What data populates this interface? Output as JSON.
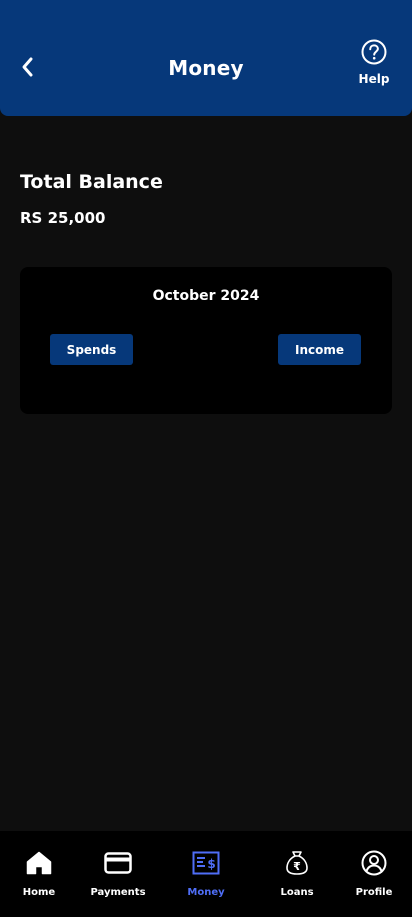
{
  "header": {
    "title": "Money",
    "help_label": "Help"
  },
  "balance": {
    "title": "Total Balance",
    "amount": "RS 25,000"
  },
  "card": {
    "month": "October 2024",
    "spends_label": "Spends",
    "income_label": "Income"
  },
  "nav": {
    "active": "Money",
    "items": [
      {
        "label": "Home",
        "icon": "home-icon"
      },
      {
        "label": "Payments",
        "icon": "card-icon"
      },
      {
        "label": "Money",
        "icon": "money-statement-icon"
      },
      {
        "label": "Loans",
        "icon": "rupee-bag-icon"
      },
      {
        "label": "Profile",
        "icon": "profile-icon"
      }
    ]
  },
  "colors": {
    "header_bg": "#06387a",
    "page_bg": "#0e0e0e",
    "card_bg": "#000000",
    "button_bg": "#06387a",
    "active_nav": "#4f6ef7"
  }
}
